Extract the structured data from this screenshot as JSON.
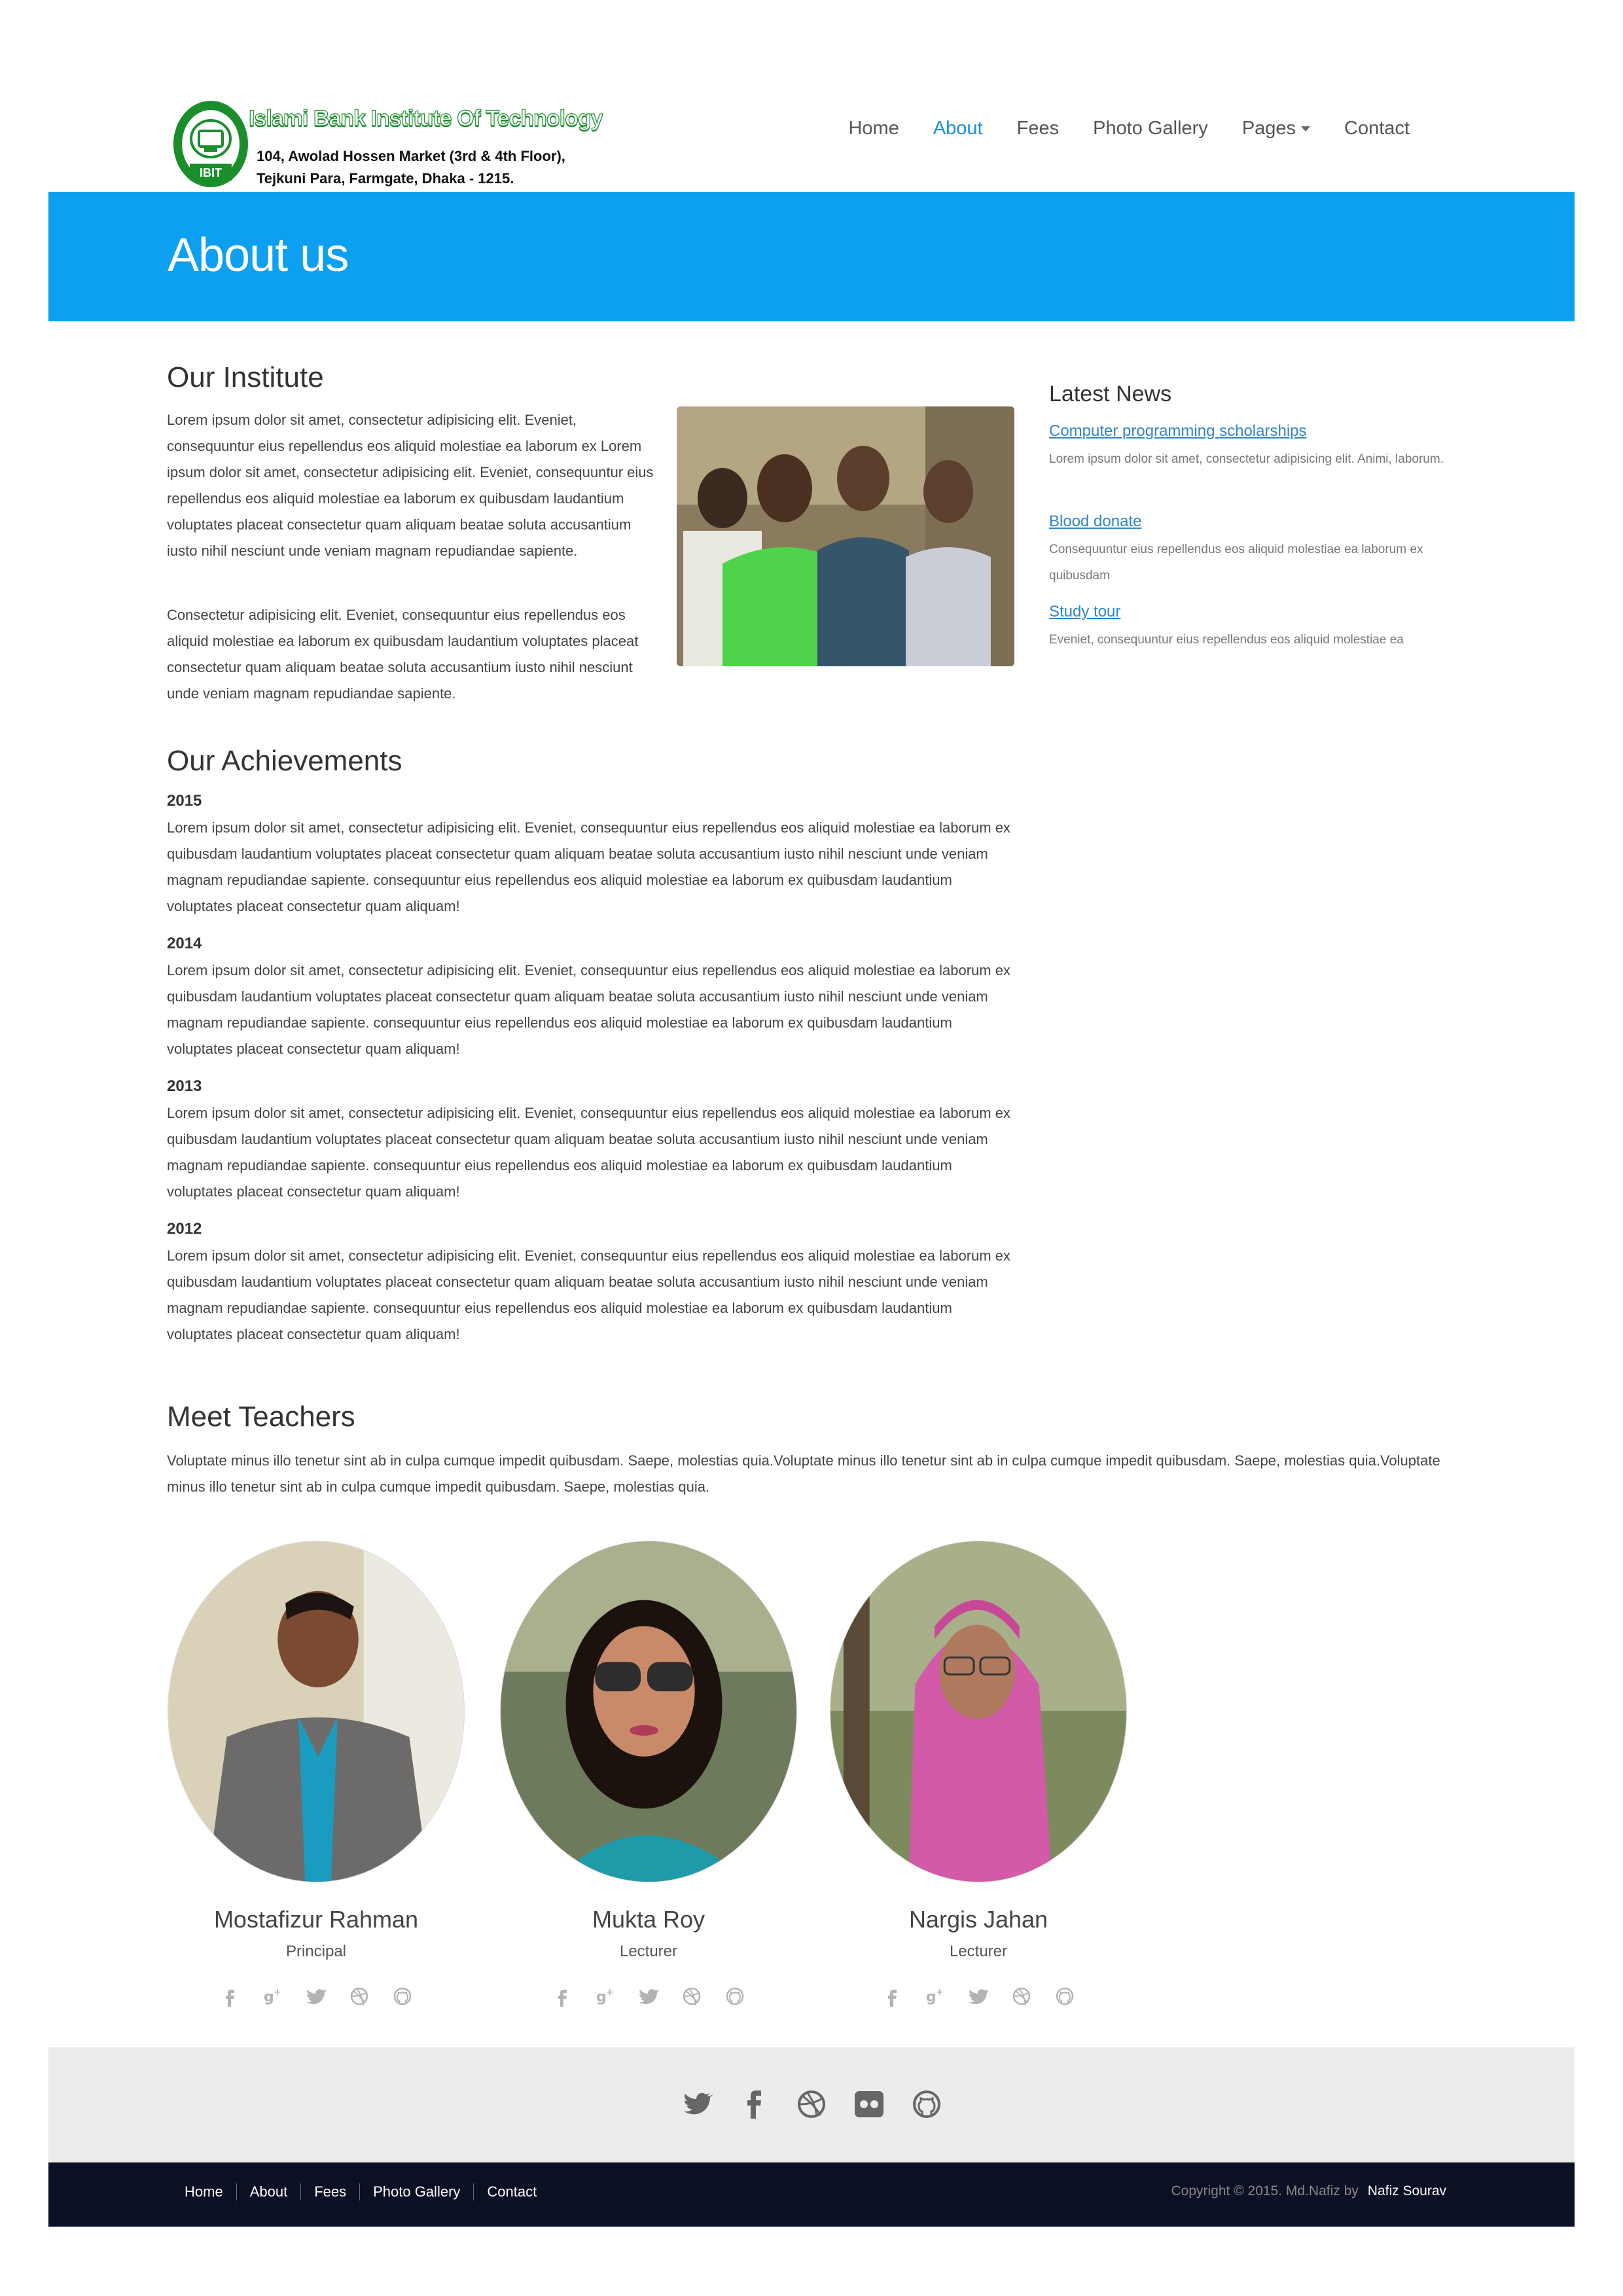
{
  "header": {
    "logo_name": "Islami Bank Institute Of Technology",
    "logo_address_line1": "104, Awolad Hossen Market (3rd & 4th Floor),",
    "logo_address_line2": "Tejkuni Para, Farmgate, Dhaka - 1215.",
    "nav": [
      "Home",
      "About",
      "Fees",
      "Photo Gallery",
      "Pages",
      "Contact"
    ],
    "active_nav": "About"
  },
  "banner": {
    "title": "About us"
  },
  "institute": {
    "heading": "Our Institute",
    "para1": "Lorem ipsum dolor sit amet, consectetur adipisicing elit. Eveniet, consequuntur eius repellendus eos aliquid molestiae ea laborum ex Lorem ipsum dolor sit amet, consectetur adipisicing elit. Eveniet, consequuntur eius repellendus eos aliquid molestiae ea laborum ex quibusdam laudantium voluptates placeat consectetur quam aliquam beatae soluta accusantium iusto nihil nesciunt unde veniam magnam repudiandae sapiente.",
    "para2": "Consectetur adipisicing elit. Eveniet, consequuntur eius repellendus eos aliquid molestiae ea laborum ex quibusdam laudantium voluptates placeat consectetur quam aliquam beatae soluta accusantium iusto nihil nesciunt unde veniam magnam repudiandae sapiente."
  },
  "achievements": {
    "heading": "Our Achievements",
    "items": [
      {
        "year": "2015",
        "text": "Lorem ipsum dolor sit amet, consectetur adipisicing elit. Eveniet, consequuntur eius repellendus eos aliquid molestiae ea laborum ex quibusdam laudantium voluptates placeat consectetur quam aliquam beatae soluta accusantium iusto nihil nesciunt unde veniam magnam repudiandae sapiente. consequuntur eius repellendus eos aliquid molestiae ea laborum ex quibusdam laudantium voluptates placeat consectetur quam aliquam!"
      },
      {
        "year": "2014",
        "text": "Lorem ipsum dolor sit amet, consectetur adipisicing elit. Eveniet, consequuntur eius repellendus eos aliquid molestiae ea laborum ex quibusdam laudantium voluptates placeat consectetur quam aliquam beatae soluta accusantium iusto nihil nesciunt unde veniam magnam repudiandae sapiente. consequuntur eius repellendus eos aliquid molestiae ea laborum ex quibusdam laudantium voluptates placeat consectetur quam aliquam!"
      },
      {
        "year": "2013",
        "text": "Lorem ipsum dolor sit amet, consectetur adipisicing elit. Eveniet, consequuntur eius repellendus eos aliquid molestiae ea laborum ex quibusdam laudantium voluptates placeat consectetur quam aliquam beatae soluta accusantium iusto nihil nesciunt unde veniam magnam repudiandae sapiente. consequuntur eius repellendus eos aliquid molestiae ea laborum ex quibusdam laudantium voluptates placeat consectetur quam aliquam!"
      },
      {
        "year": "2012",
        "text": "Lorem ipsum dolor sit amet, consectetur adipisicing elit. Eveniet, consequuntur eius repellendus eos aliquid molestiae ea laborum ex quibusdam laudantium voluptates placeat consectetur quam aliquam beatae soluta accusantium iusto nihil nesciunt unde veniam magnam repudiandae sapiente. consequuntur eius repellendus eos aliquid molestiae ea laborum ex quibusdam laudantium voluptates placeat consectetur quam aliquam!"
      }
    ]
  },
  "sidebar": {
    "heading": "Latest News",
    "news": [
      {
        "title": "Computer programming scholarships",
        "text": "Lorem ipsum dolor sit amet, consectetur adipisicing elit. Animi, laborum."
      },
      {
        "title": "Blood donate",
        "text": "Consequuntur eius repellendus eos aliquid molestiae ea laborum ex quibusdam"
      },
      {
        "title": "Study tour",
        "text": "Eveniet, consequuntur eius repellendus eos aliquid molestiae ea"
      }
    ]
  },
  "teachers": {
    "heading": "Meet Teachers",
    "intro": "Voluptate minus illo tenetur sint ab in culpa cumque impedit quibusdam. Saepe, molestias quia.Voluptate minus illo tenetur sint ab in culpa cumque impedit quibusdam. Saepe, molestias quia.Voluptate minus illo tenetur sint ab in culpa cumque impedit quibusdam. Saepe, molestias quia.",
    "list": [
      {
        "name": "Mostafizur Rahman",
        "role": "Principal"
      },
      {
        "name": "Mukta Roy",
        "role": "Lecturer"
      },
      {
        "name": "Nargis Jahan",
        "role": "Lecturer"
      }
    ],
    "social_icons": [
      "facebook-icon",
      "google-plus-icon",
      "twitter-icon",
      "dribbble-icon",
      "github-icon"
    ]
  },
  "footer": {
    "icons": [
      "twitter-icon",
      "facebook-icon",
      "dribbble-icon",
      "flickr-icon",
      "github-icon"
    ],
    "links": [
      "Home",
      "About",
      "Fees",
      "Photo Gallery",
      "Contact"
    ],
    "copyright": "Copyright © 2015. Md.Nafiz by",
    "author": "Nafiz Sourav"
  },
  "colors": {
    "banner": "#0ea0f0",
    "link": "#2f85c8",
    "nav_active": "#1a8ee0",
    "footer_dark": "#0b1024",
    "footer_light": "#ececec",
    "logo_green": "#1a8e2b"
  }
}
